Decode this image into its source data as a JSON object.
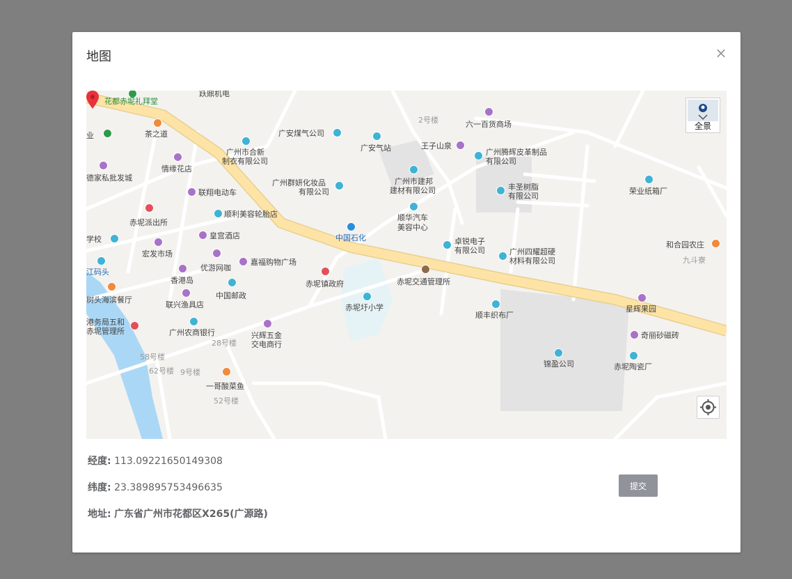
{
  "dialog": {
    "title": "地图",
    "close_glyph": "×",
    "submit_label": "提交"
  },
  "map": {
    "panorama_label": "全景",
    "labels": [
      "跃鼎机电",
      "花都赤坭礼拜堂",
      "茶之道",
      "业",
      "广州市合新",
      "制衣有限公司",
      "广安煤气公司",
      "2号楼",
      "六一百货商场",
      "广安气站",
      "王子山泉",
      "广州腾辉皮革制品",
      "有限公司",
      "德家私批发城",
      "情缘花店",
      "广州群妍化妆品",
      "有限公司",
      "广州市建邦",
      "建材有限公司",
      "丰圣树脂",
      "有限公司",
      "荣业纸箱厂",
      "联翔电动车",
      "顺利美容轮胎店",
      "顺华汽车",
      "美容中心",
      "赤坭派出所",
      "皇宫酒店",
      "中国石化",
      "卓锐电子",
      "有限公司",
      "广州四耀超硬",
      "材料有限公司",
      "和合园农庄",
      "九斗寮",
      "学校",
      "宏发市场",
      "优游网咖",
      "嘉福购物广场",
      "江码头",
      "香港岛",
      "赤坭镇政府",
      "赤坭交通管理所",
      "树头海滨餐厅",
      "联兴渔具店",
      "中国邮政",
      "赤坭圩小学",
      "顺丰织布厂",
      "星辉果园",
      "港务局五和",
      "赤坭管理所",
      "广州农商银行",
      "兴辉五金",
      "交电商行",
      "28号楼",
      "奇丽砂磁砖",
      "58号楼",
      "62号楼",
      "9号楼",
      "锦盈公司",
      "赤坭陶瓷厂",
      "一哥酸菜鱼",
      "52号楼"
    ]
  },
  "info": {
    "longitude_key": "经度:",
    "longitude_val": "113.09221650149308",
    "latitude_key": "纬度:",
    "latitude_val": "23.389895753496635",
    "address_key": "地址:",
    "address_val": "广东省广州市花都区X265(广源路)"
  },
  "colors": {
    "overlay": "#7f7f7f",
    "map_bg": "#f3f2ef",
    "main_road": "#fde4a6",
    "river": "#aad7f5",
    "pin": "#e8323a",
    "submit_btn": "#909399"
  }
}
